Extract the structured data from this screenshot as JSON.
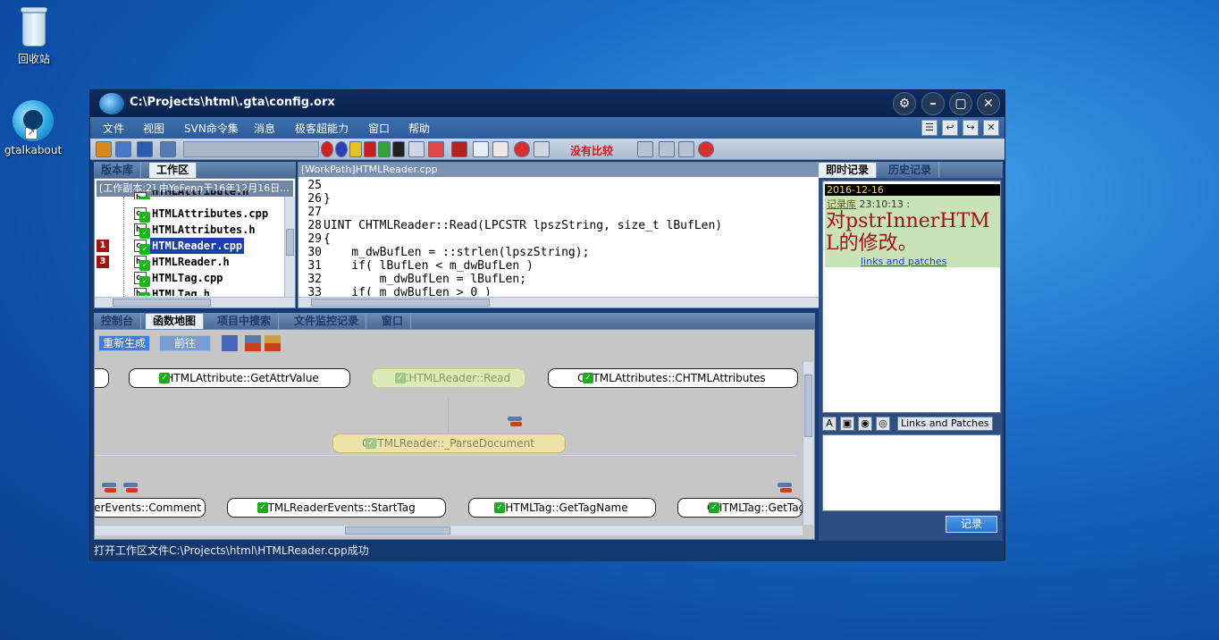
{
  "desktop": {
    "recycle_bin_label": "回收站",
    "gtalk_label": "gtalkabout"
  },
  "window": {
    "title": "C:\\Projects\\html\\.gta\\config.orx"
  },
  "menu": [
    "文件",
    "视图",
    "SVN命令集",
    "消息",
    "极客超能力",
    "窗口",
    "帮助"
  ],
  "toolbar": {
    "compare_status": "没有比较"
  },
  "left_panel": {
    "tabs": [
      "版本库",
      "工作区"
    ],
    "working_copy_header": "[工作副本:2] 由YeFeng于16年12月16日...",
    "files": [
      {
        "marker": "",
        "icon": "h",
        "name": "HTMLAttribute.h"
      },
      {
        "marker": "",
        "icon": "c",
        "name": "HTMLAttributes.cpp"
      },
      {
        "marker": "",
        "icon": "h",
        "name": "HTMLAttributes.h"
      },
      {
        "marker": "1",
        "icon": "c",
        "name": "HTMLReader.cpp",
        "selected": true
      },
      {
        "marker": "3",
        "icon": "h",
        "name": "HTMLReader.h"
      },
      {
        "marker": "",
        "icon": "c",
        "name": "HTMLTag.cpp"
      },
      {
        "marker": "",
        "icon": "h",
        "name": "HTMLTag.h"
      }
    ]
  },
  "editor": {
    "path": "[WorkPath]HTMLReader.cpp",
    "lines": [
      {
        "no": "25",
        "text": ""
      },
      {
        "no": "26",
        "text": "}"
      },
      {
        "no": "27",
        "text": ""
      },
      {
        "no": "28",
        "text": "UINT CHTMLReader::Read(LPCSTR lpszString, size_t lBufLen)"
      },
      {
        "no": "29",
        "text": "{"
      },
      {
        "no": "30",
        "text": "    m_dwBufLen = ::strlen(lpszString);"
      },
      {
        "no": "31",
        "text": "    if( lBufLen < m_dwBufLen )"
      },
      {
        "no": "32",
        "text": "        m_dwBufLen = lBufLen;"
      },
      {
        "no": "33",
        "text": "    if( m_dwBufLen > 0 )"
      }
    ]
  },
  "bottom_panel": {
    "tabs": [
      "控制台",
      "函数地图",
      "项目中搜索",
      "文件监控记录",
      "窗口"
    ],
    "buttons": {
      "regenerate": "重新生成",
      "forward": "前往"
    },
    "nodes": {
      "left_stub": "",
      "get_attr_value": "CHTMLAttribute::GetAttrValue",
      "read": "CHTMLReader::Read",
      "attributes_ctor": "CHTMLAttributes::CHTMLAttributes",
      "parse_document": "CHTMLReader::_ParseDocument",
      "comment": "IHTMLReaderEvents::Comment",
      "start_tag": "IHTMLReaderEvents::StartTag",
      "get_tag_name": "CHTMLTag::GetTagName",
      "get_partial": "CHTMLTag::GetTagName"
    }
  },
  "right_panel": {
    "tabs": [
      "即时记录",
      "历史记录"
    ],
    "log": {
      "date": "2016-12-16",
      "author": "记录库",
      "time": "23:10:13 :",
      "message": "对pstrInnerHTML的修改。",
      "link": "links and patches"
    },
    "format_label": "Links and Patches",
    "record_button": "记录"
  },
  "status": {
    "text": "打开工作区文件C:\\Projects\\html\\HTMLReader.cpp成功"
  },
  "colors": {
    "accent": "#2a74d0",
    "selection": "#1a3fa8",
    "marker": "#a41414",
    "compare_warning": "#e21414"
  }
}
